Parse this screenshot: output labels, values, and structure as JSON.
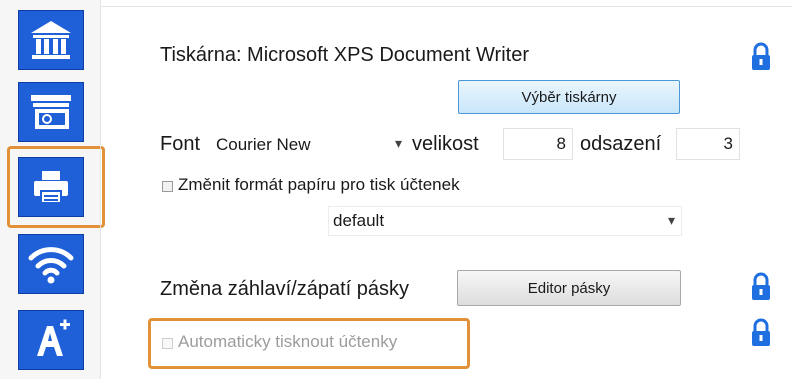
{
  "sidebar": {
    "items": [
      {
        "name": "home",
        "icon": "bank-icon"
      },
      {
        "name": "payments",
        "icon": "cash-register-icon"
      },
      {
        "name": "printer",
        "icon": "printer-icon",
        "selected": true
      },
      {
        "name": "wifi",
        "icon": "wifi-icon"
      },
      {
        "name": "font",
        "icon": "font-add-icon"
      }
    ]
  },
  "printer": {
    "label": "Tiskárna: Microsoft XPS Document Writer",
    "select_button": "Výběr tiskárny"
  },
  "font": {
    "label": "Font",
    "value": "Courier New",
    "size_label": "velikost",
    "size_value": "8",
    "indent_label": "odsazení",
    "indent_value": "3"
  },
  "paper_format": {
    "checkbox_label": "Změnit formát papíru pro tisk účtenek",
    "value": "default"
  },
  "header_footer": {
    "label": "Změna záhlaví/zápatí pásky",
    "button": "Editor pásky"
  },
  "auto_print": {
    "checkbox_label": "Automaticky tisknout účtenky"
  },
  "colors": {
    "accent": "#1f5fd8",
    "lock": "#1f6fe0",
    "highlight": "#e0913a"
  }
}
